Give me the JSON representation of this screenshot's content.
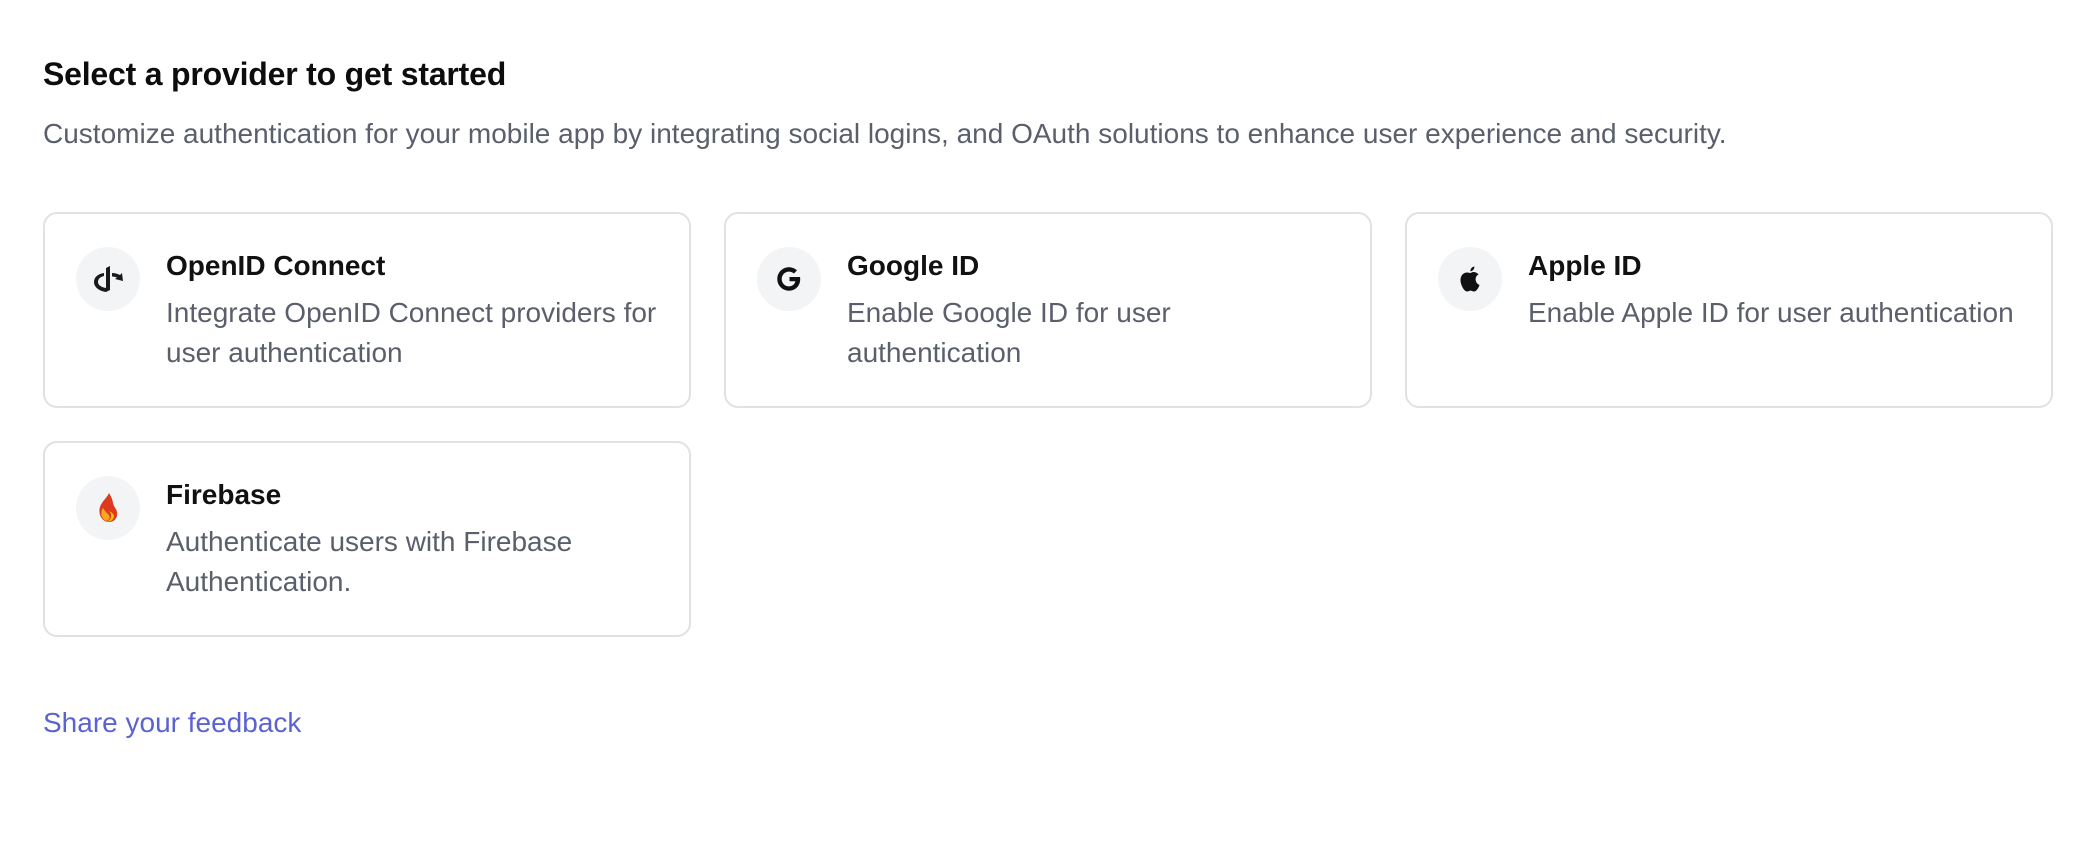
{
  "header": {
    "title": "Select a provider to get started",
    "subtitle": "Customize authentication for your mobile app by integrating social logins, and OAuth solutions to enhance user experience and security."
  },
  "providers": [
    {
      "title": "OpenID Connect",
      "description": "Integrate OpenID Connect providers for user authentication",
      "icon": "openid-icon"
    },
    {
      "title": "Google ID",
      "description": "Enable Google ID for user authentication",
      "icon": "google-icon"
    },
    {
      "title": "Apple ID",
      "description": "Enable Apple ID for user authentication",
      "icon": "apple-icon"
    },
    {
      "title": "Firebase",
      "description": "Authenticate users with Firebase Authentication.",
      "icon": "firebase-icon"
    }
  ],
  "footer": {
    "feedback_label": "Share your feedback"
  },
  "colors": {
    "link": "#5b63d3",
    "border": "#dfe1e5",
    "muted_text": "#5a5f6b",
    "icon_bg": "#f3f4f6"
  }
}
